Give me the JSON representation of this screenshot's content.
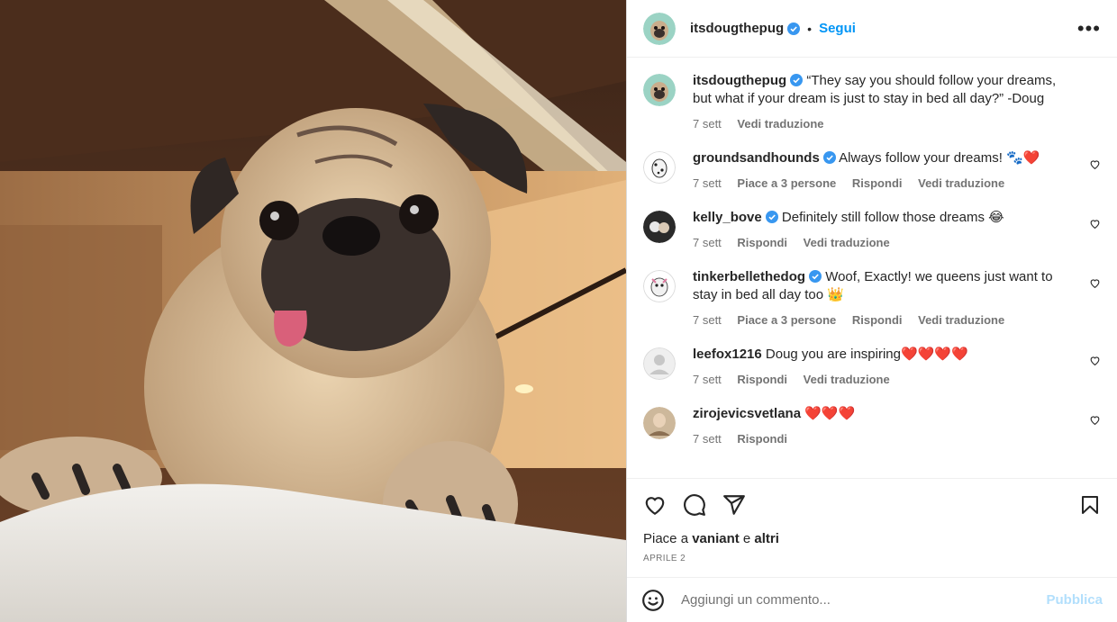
{
  "header": {
    "username": "itsdougthepug",
    "separator": "•",
    "follow_label": "Segui",
    "more_label": "•••"
  },
  "caption": {
    "username": "itsdougthepug",
    "text": "“They say you should follow your dreams, but what if your dream is just to stay in bed all day?” -Doug",
    "time": "7 sett",
    "translate": "Vedi traduzione"
  },
  "comments": [
    {
      "username": "groundsandhounds",
      "verified": true,
      "text": "Always follow your dreams! 🐾❤️",
      "time": "7 sett",
      "likes": "Piace a 3 persone",
      "reply": "Rispondi",
      "translate": "Vedi traduzione"
    },
    {
      "username": "kelly_bove",
      "verified": true,
      "text": "Definitely still follow those dreams 😂",
      "time": "7 sett",
      "reply": "Rispondi",
      "translate": "Vedi traduzione"
    },
    {
      "username": "tinkerbellethedog",
      "verified": true,
      "text": "Woof, Exactly! we queens just want to stay in bed all day too 👑",
      "time": "7 sett",
      "likes": "Piace a 3 persone",
      "reply": "Rispondi",
      "translate": "Vedi traduzione"
    },
    {
      "username": "leefox1216",
      "verified": false,
      "text": "Doug you are inspiring❤️❤️❤️❤️",
      "time": "7 sett",
      "reply": "Rispondi",
      "translate": "Vedi traduzione"
    },
    {
      "username": "zirojevicsvetlana",
      "verified": false,
      "text": "❤️❤️❤️",
      "time": "7 sett",
      "reply": "Rispondi"
    }
  ],
  "post": {
    "likes_prefix": "Piace a",
    "likes_user": "vaniant",
    "likes_join": "e",
    "likes_others": "altri",
    "date": "APRILE 2"
  },
  "composer": {
    "placeholder": "Aggiungi un commento...",
    "publish_label": "Pubblica"
  },
  "colors": {
    "accent": "#0095f6",
    "verified": "#3897f0",
    "muted": "#737373",
    "publish_disabled": "#b2dffc"
  }
}
